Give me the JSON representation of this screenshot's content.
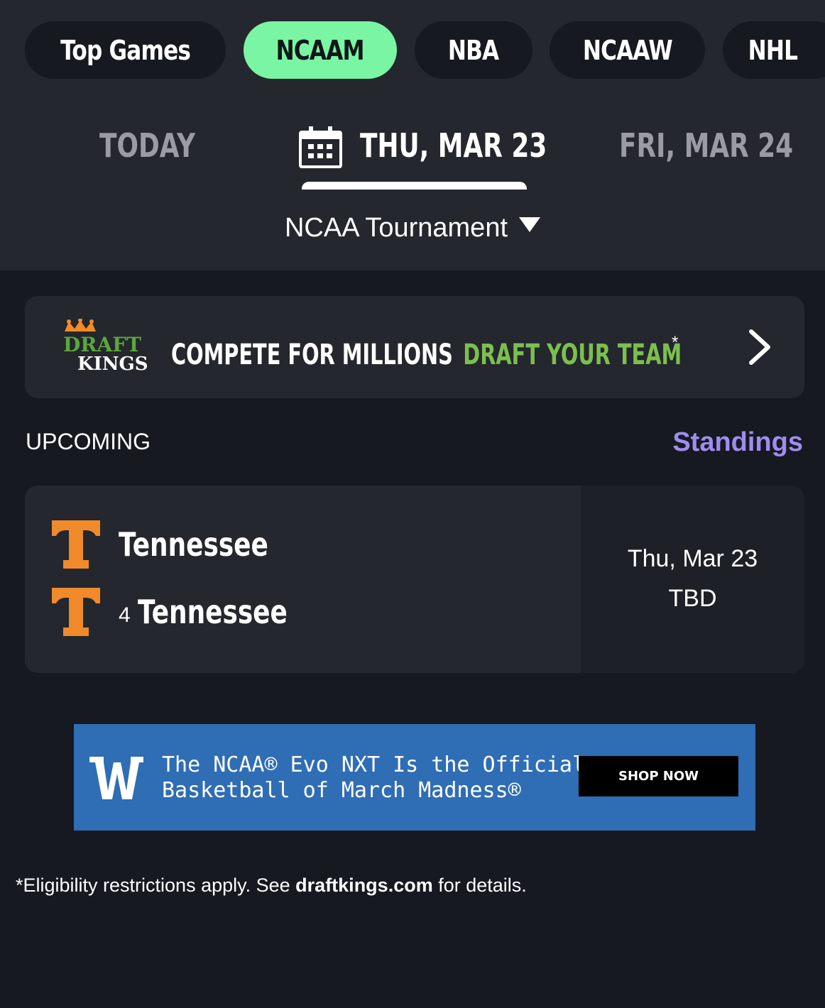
{
  "league_tabs": [
    {
      "label": "Top Games",
      "active": false
    },
    {
      "label": "NCAAM",
      "active": true
    },
    {
      "label": "NBA",
      "active": false
    },
    {
      "label": "NCAAW",
      "active": false
    },
    {
      "label": "NHL",
      "active": false
    }
  ],
  "date_tabs": {
    "today": "TODAY",
    "selected": "THU, MAR 23",
    "next": "FRI, MAR 24",
    "selected_icon": "calendar-icon"
  },
  "filter": {
    "label": "NCAA Tournament",
    "icon": "caret-down-icon"
  },
  "promo": {
    "logo_text_top": "DRAFT",
    "logo_text_bottom": "KINGS",
    "headline": "COMPETE FOR MILLIONS",
    "cta": "DRAFT YOUR TEAM",
    "asterisk": "*",
    "icon": "chevron-right-icon",
    "cta_color": "#7cbf4e"
  },
  "section": {
    "title": "UPCOMING",
    "link": "Standings",
    "link_color": "#a08cf0"
  },
  "game": {
    "teams": [
      {
        "seed": "",
        "name": "Tennessee",
        "logo": "tennessee-t-logo"
      },
      {
        "seed": "4",
        "name": "Tennessee",
        "logo": "tennessee-t-logo"
      }
    ],
    "date": "Thu, Mar 23",
    "time": "TBD",
    "team_color": "#f08a2b"
  },
  "ad": {
    "logo": "wilson-w-logo",
    "line1": "The NCAA® Evo NXT Is the Official",
    "line2": "Basketball of March Madness®",
    "button": "SHOP NOW",
    "background": "#2f6db5"
  },
  "footer": {
    "prefix": "*Eligibility restrictions apply. See ",
    "link": "draftkings.com",
    "suffix": " for details."
  },
  "colors": {
    "accent": "#7af5a3",
    "background": "#161920",
    "surface": "#24272d"
  }
}
